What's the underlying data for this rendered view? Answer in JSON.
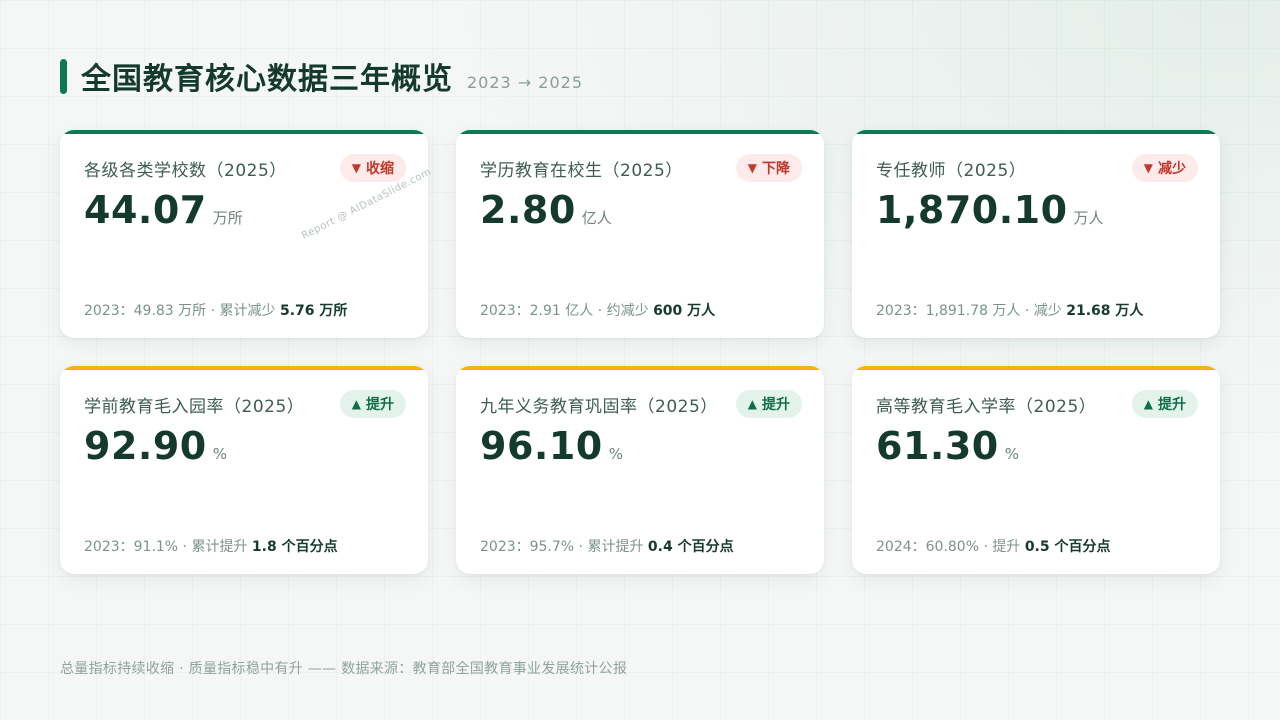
{
  "header": {
    "title": "全国教育核心数据三年概览",
    "subtitle": "2023 → 2025"
  },
  "colors": {
    "accent_green": "#0e7a55",
    "accent_yellow": "#f5b40a",
    "down_badge": "#c0392b",
    "up_badge": "#0e6e4c"
  },
  "cards": [
    {
      "label": "各级各类学校数（2025）",
      "badge_arrow": "▼",
      "badge_text": "收缩",
      "value": "44.07",
      "unit": "万所",
      "note_text": "2023：49.83 万所 · 累计减少 ",
      "note_strong": "5.76 万所"
    },
    {
      "label": "学历教育在校生（2025）",
      "badge_arrow": "▼",
      "badge_text": "下降",
      "value": "2.80",
      "unit": "亿人",
      "note_text": "2023：2.91 亿人 · 约减少 ",
      "note_strong": "600 万人"
    },
    {
      "label": "专任教师（2025）",
      "badge_arrow": "▼",
      "badge_text": "减少",
      "value": "1,870.10",
      "unit": "万人",
      "note_text": "2023：1,891.78 万人 · 减少 ",
      "note_strong": "21.68 万人"
    },
    {
      "label": "学前教育毛入园率（2025）",
      "badge_arrow": "▲",
      "badge_text": "提升",
      "value": "92.90",
      "unit": "%",
      "note_text": "2023：91.1% · 累计提升 ",
      "note_strong": "1.8 个百分点"
    },
    {
      "label": "九年义务教育巩固率（2025）",
      "badge_arrow": "▲",
      "badge_text": "提升",
      "value": "96.10",
      "unit": "%",
      "note_text": "2023：95.7% · 累计提升 ",
      "note_strong": "0.4 个百分点"
    },
    {
      "label": "高等教育毛入学率（2025）",
      "badge_arrow": "▲",
      "badge_text": "提升",
      "value": "61.30",
      "unit": "%",
      "note_text": "2024：60.80% · 提升 ",
      "note_strong": "0.5 个百分点"
    }
  ],
  "watermark": "Report @ AIDataSlide.com",
  "footer": "总量指标持续收缩 · 质量指标稳中有升 —— 数据来源：教育部全国教育事业发展统计公报"
}
